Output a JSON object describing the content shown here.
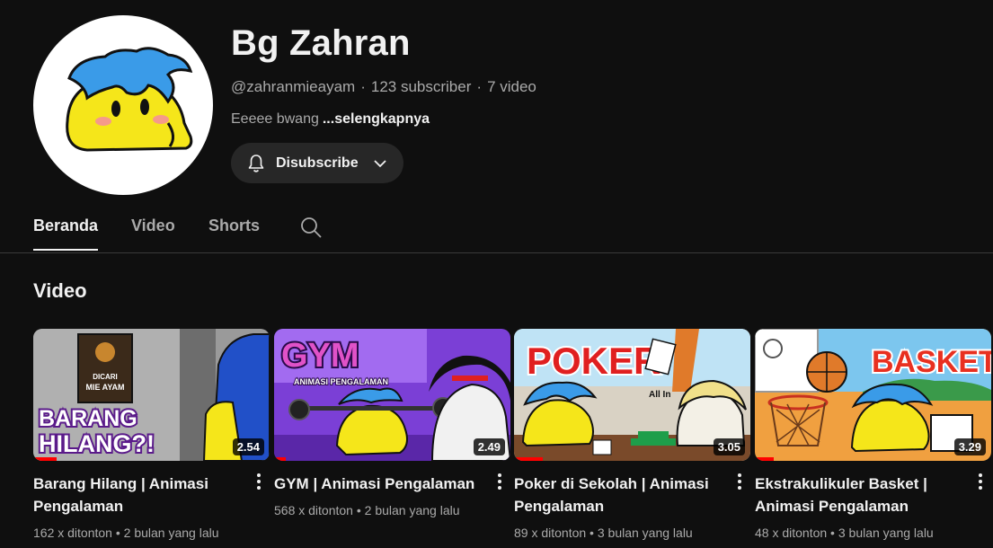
{
  "channel": {
    "name": "Bg Zahran",
    "handle": "@zahranmieayam",
    "subscribers": "123 subscriber",
    "video_count": "7 video",
    "description": "Eeeee bwang",
    "more_label": "...selengkapnya",
    "subscribe_label": "Disubscribe"
  },
  "tabs": [
    {
      "label": "Beranda",
      "active": true
    },
    {
      "label": "Video",
      "active": false
    },
    {
      "label": "Shorts",
      "active": false
    }
  ],
  "section": {
    "title": "Video"
  },
  "videos": [
    {
      "title": "Barang Hilang | Animasi Pengalaman",
      "duration": "2.54",
      "views": "162 x ditonton",
      "age": "2 bulan yang lalu",
      "thumb_text": "BARANG HILANG?!",
      "sign_text": "DICARI MIE AYAM",
      "watched_fraction": 0.1
    },
    {
      "title": "GYM | Animasi Pengalaman",
      "duration": "2.49",
      "views": "568 x ditonton",
      "age": "2 bulan yang lalu",
      "thumb_text": "GYM",
      "sub_text": "ANIMASI PENGALAMAN",
      "watched_fraction": 0.05
    },
    {
      "title": "Poker di Sekolah | Animasi Pengalaman",
      "duration": "3.05",
      "views": "89 x ditonton",
      "age": "3 bulan yang lalu",
      "thumb_text": "POKER",
      "sub_text": "All In",
      "watched_fraction": 0.12
    },
    {
      "title": "Ekstrakulikuler Basket | Animasi Pengalaman",
      "duration": "3.29",
      "views": "48 x ditonton",
      "age": "3 bulan yang lalu",
      "thumb_text": "BASKET",
      "watched_fraction": 0.08
    }
  ],
  "icons": {
    "bell": "bell-icon",
    "chevron": "chevron-down-icon",
    "search": "search-icon",
    "more": "more-vert-icon"
  },
  "colors": {
    "background": "#0f0f0f",
    "text_primary": "#f1f1f1",
    "text_secondary": "#aaaaaa",
    "button_bg": "#272727",
    "progress": "#ff0000"
  }
}
